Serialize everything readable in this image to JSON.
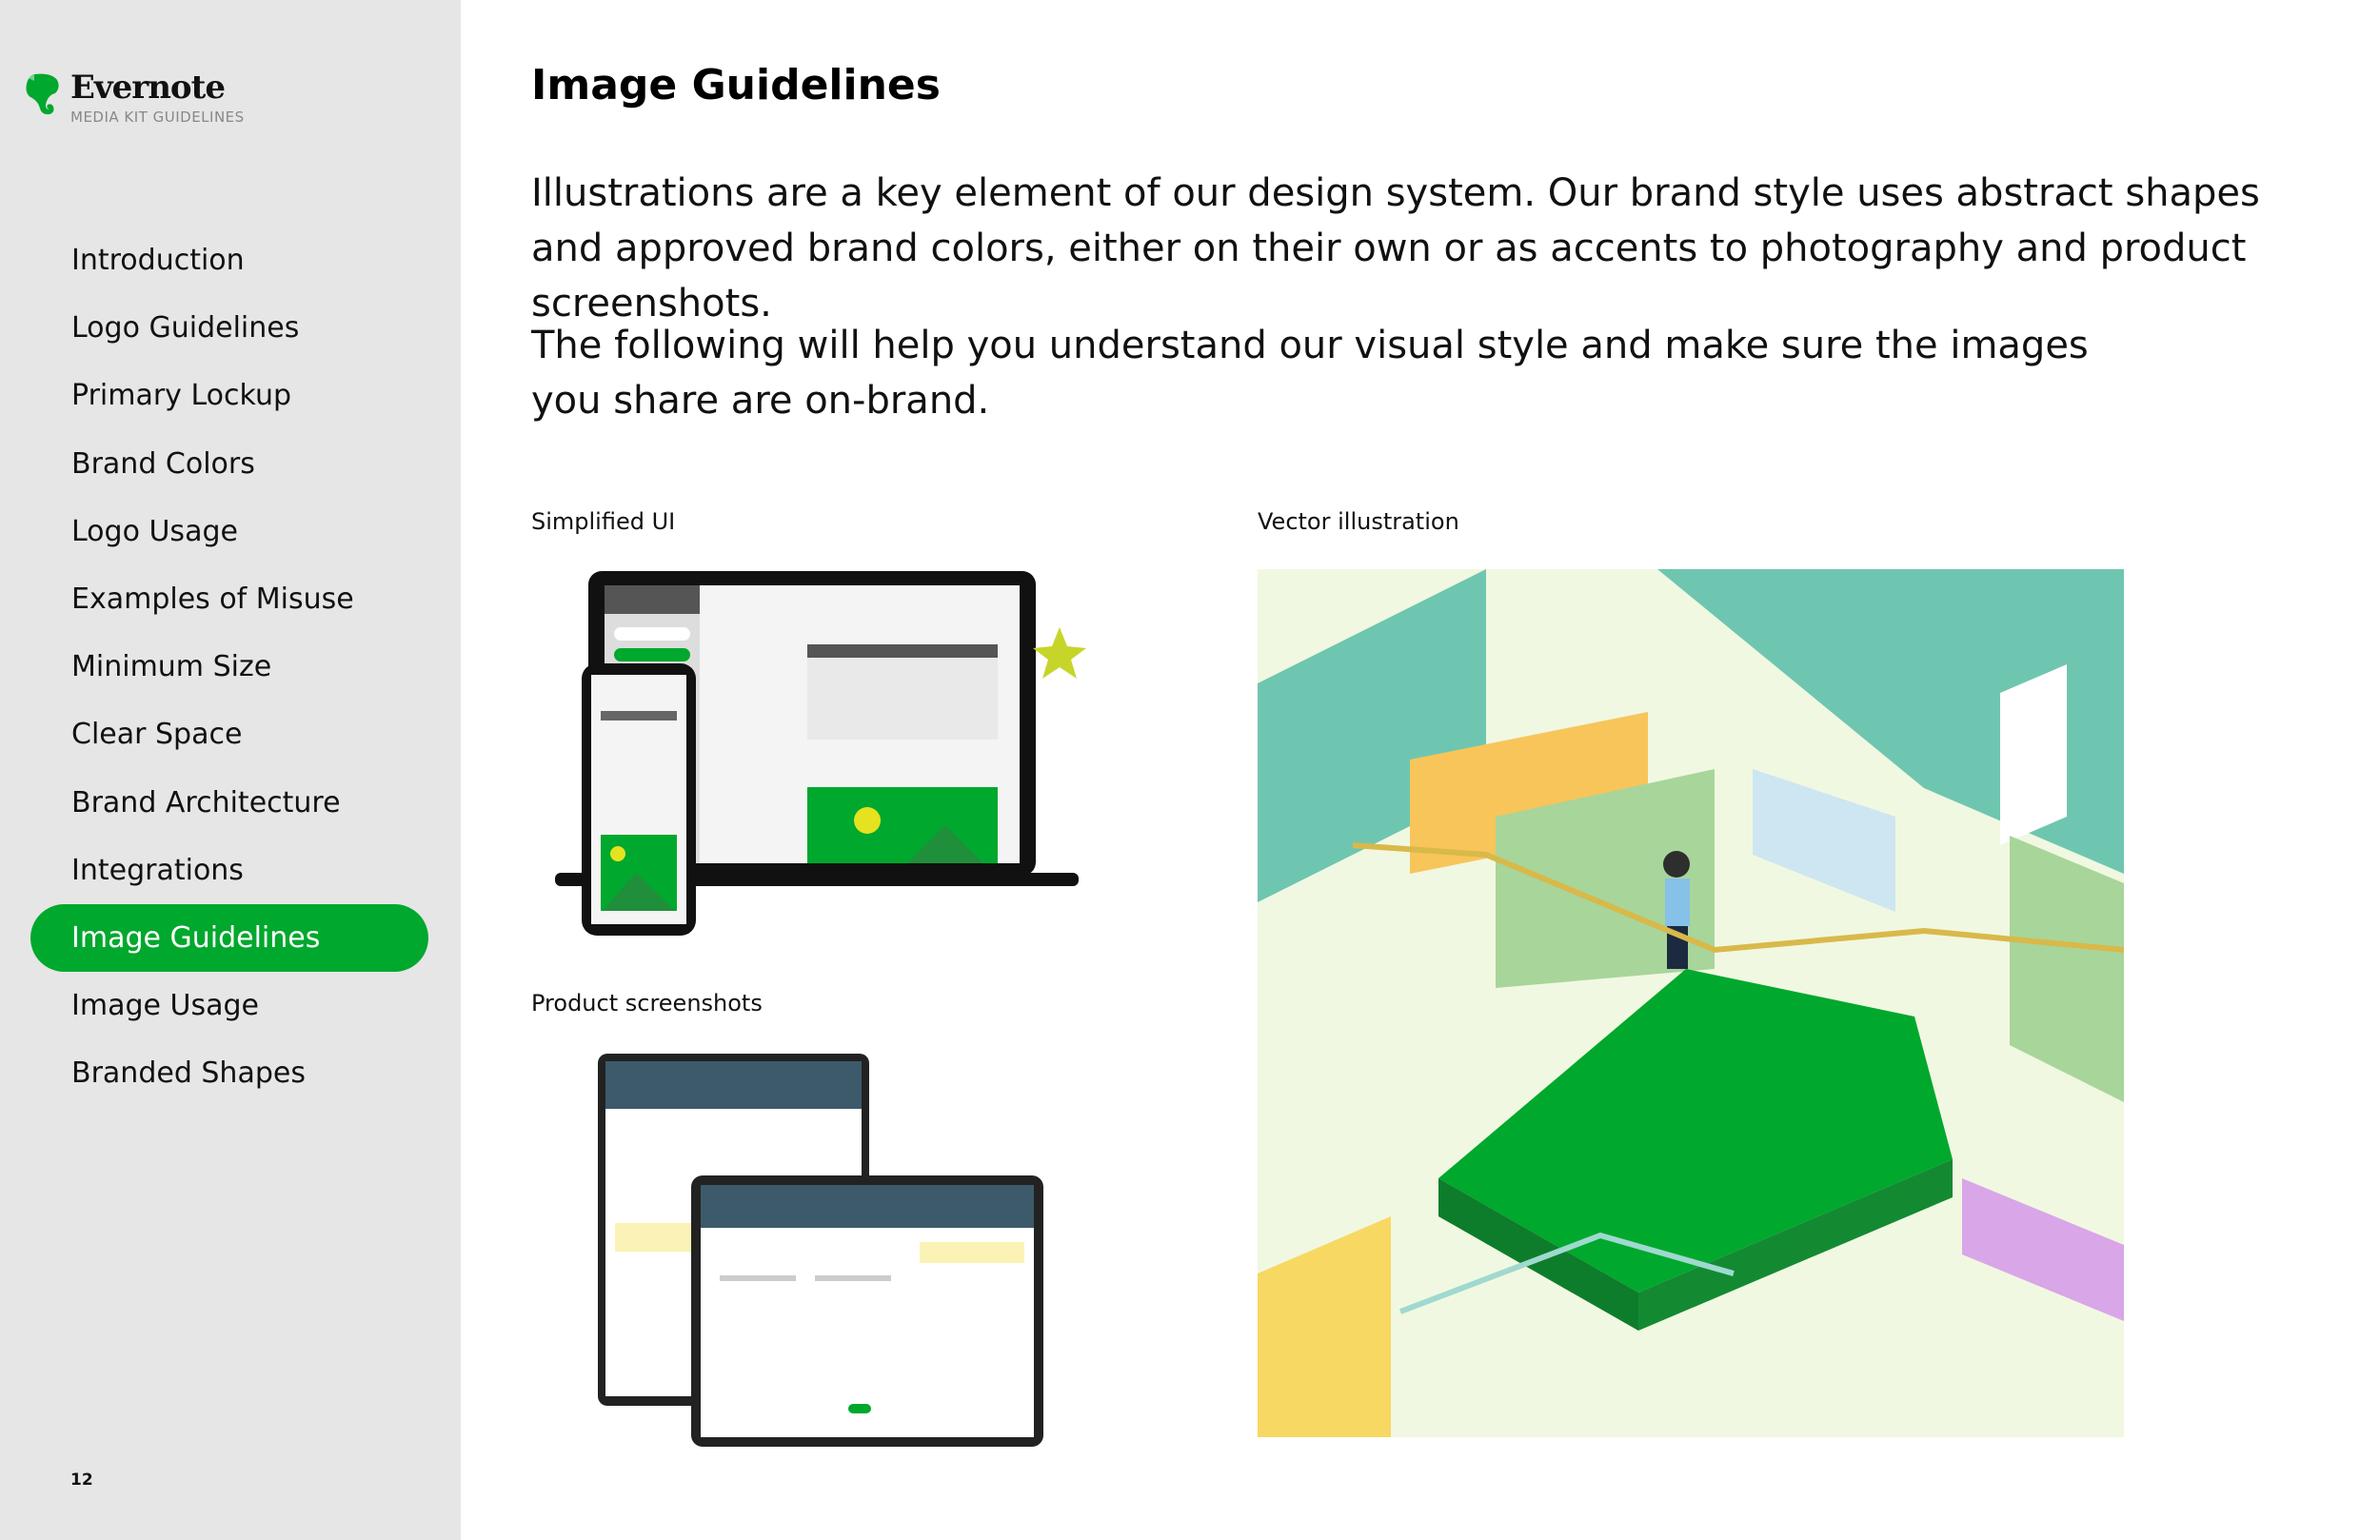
{
  "brand": {
    "name": "Evernote",
    "subtitle": "MEDIA KIT GUIDELINES",
    "accent": "#00a82d"
  },
  "sidebar": {
    "items": [
      {
        "label": "Introduction"
      },
      {
        "label": "Logo Guidelines"
      },
      {
        "label": "Primary Lockup"
      },
      {
        "label": "Brand Colors"
      },
      {
        "label": "Logo Usage"
      },
      {
        "label": "Examples of Misuse"
      },
      {
        "label": "Minimum Size"
      },
      {
        "label": "Clear Space"
      },
      {
        "label": "Brand Architecture"
      },
      {
        "label": "Integrations"
      },
      {
        "label": "Image Guidelines",
        "active": true
      },
      {
        "label": "Image Usage"
      },
      {
        "label": "Branded Shapes"
      }
    ],
    "page_number": "12"
  },
  "main": {
    "title": "Image Guidelines",
    "paragraphs": [
      "Illustrations are a key element of our design system. Our brand style uses abstract shapes and approved brand colors, either on their own or as accents to photography and product screenshots.",
      "The following will help you understand our visual style and make sure the images you share are on-brand."
    ],
    "figures": {
      "simplified_ui": "Simplified UI",
      "product_screenshots": "Product screenshots",
      "vector_illustration": "Vector illustration"
    }
  }
}
